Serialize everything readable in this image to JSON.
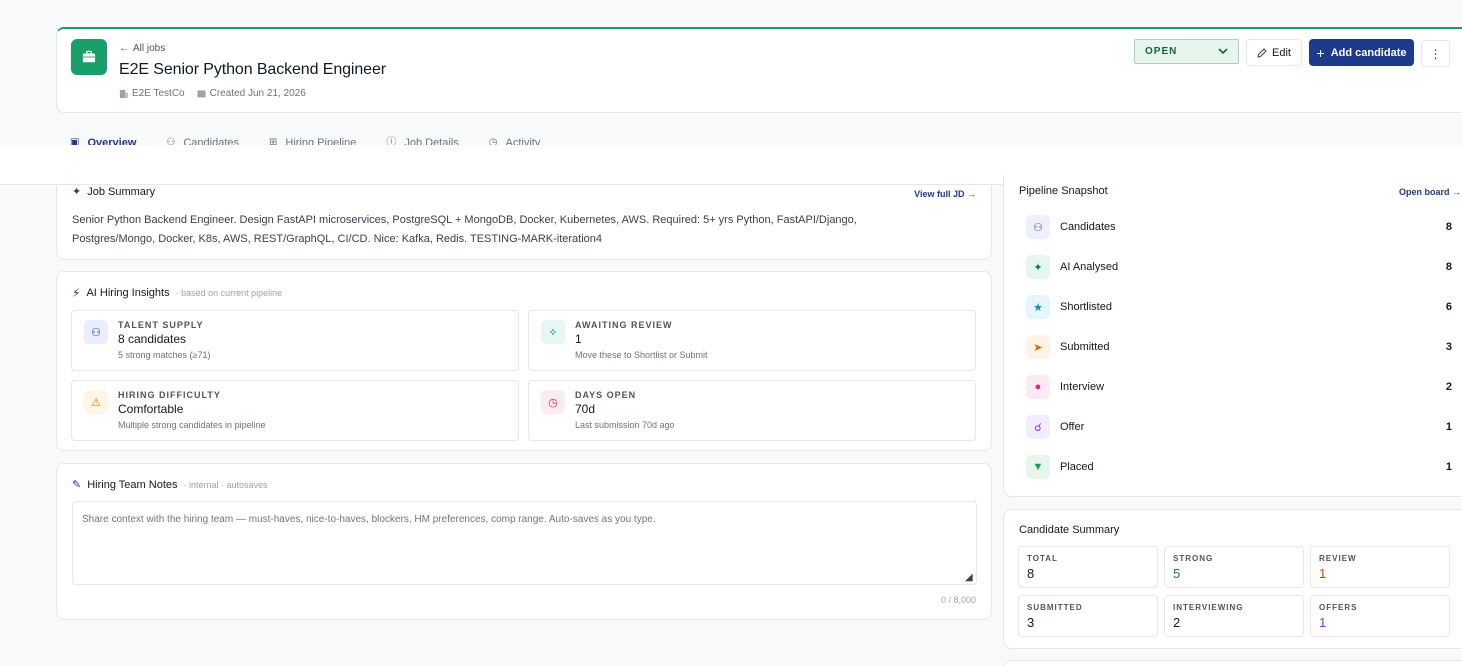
{
  "header": {
    "back_label": "All jobs",
    "title": "E2E Senior Python Backend Engineer",
    "company": "E2E TestCo",
    "created": "Created Jun 21, 2026",
    "status": "OPEN",
    "edit_label": "Edit",
    "add_candidate_label": "Add candidate",
    "more_label": "⋮",
    "colors": {
      "accent": "#1a9f6b",
      "primary": "#1e3a8a"
    }
  },
  "tabs": [
    {
      "label": "Overview",
      "icon": "overview-icon",
      "active": true
    },
    {
      "label": "Candidates",
      "icon": "users-icon",
      "active": false
    },
    {
      "label": "Hiring Pipeline",
      "icon": "kanban-icon",
      "active": false
    },
    {
      "label": "Job Details",
      "icon": "info-icon",
      "active": false
    },
    {
      "label": "Activity",
      "icon": "clock-icon",
      "active": false
    }
  ],
  "job_summary": {
    "title": "Job Summary",
    "link": "View full JD →",
    "text": "Senior Python Backend Engineer. Design FastAPI microservices, PostgreSQL + MongoDB, Docker, Kubernetes, AWS. Required: 5+ yrs Python, FastAPI/Django, Postgres/Mongo, Docker, K8s, AWS, REST/GraphQL, CI/CD. Nice: Kafka, Redis. TESTING-MARK-iteration4"
  },
  "insights": {
    "title": "AI Hiring Insights",
    "subtitle": "· based on current pipeline",
    "cards": [
      {
        "label": "TALENT SUPPLY",
        "value": "8 candidates",
        "sub": "5 strong matches (≥71)",
        "icon": "users-icon"
      },
      {
        "label": "AWAITING REVIEW",
        "value": "1",
        "sub": "Move these to Shortlist or Submit",
        "icon": "sparkle-icon"
      },
      {
        "label": "HIRING DIFFICULTY",
        "value": "Comfortable",
        "sub": "Multiple strong candidates in pipeline",
        "icon": "warning-icon"
      },
      {
        "label": "DAYS OPEN",
        "value": "70d",
        "sub": "Last submission 70d ago",
        "icon": "clock-icon"
      }
    ]
  },
  "notes": {
    "title": "Hiring Team Notes",
    "subtitle": "· internal · autosaves",
    "placeholder": "Share context with the hiring team — must-haves, nice-to-haves, blockers, HM preferences, comp range. Auto-saves as you type.",
    "count": "0 / 8,000"
  },
  "pipeline": {
    "title": "Pipeline Snapshot",
    "link": "Open board →",
    "rows": [
      {
        "label": "Candidates",
        "value": "8",
        "icon": "users-icon"
      },
      {
        "label": "AI Analysed",
        "value": "8",
        "icon": "sparkle-icon"
      },
      {
        "label": "Shortlisted",
        "value": "6",
        "icon": "star-icon"
      },
      {
        "label": "Submitted",
        "value": "3",
        "icon": "send-icon"
      },
      {
        "label": "Interview",
        "value": "2",
        "icon": "chat-icon"
      },
      {
        "label": "Offer",
        "value": "1",
        "icon": "handshake-icon"
      },
      {
        "label": "Placed",
        "value": "1",
        "icon": "trophy-icon"
      }
    ]
  },
  "candidate_summary": {
    "title": "Candidate Summary",
    "stats": [
      {
        "label": "TOTAL",
        "value": "8",
        "color": "#111827"
      },
      {
        "label": "STRONG",
        "value": "5",
        "color": "#15803d"
      },
      {
        "label": "REVIEW",
        "value": "1",
        "color": "#c2410c"
      },
      {
        "label": "SUBMITTED",
        "value": "3",
        "color": "#111827"
      },
      {
        "label": "INTERVIEWING",
        "value": "2",
        "color": "#111827"
      },
      {
        "label": "OFFERS",
        "value": "1",
        "color": "#7c3aed"
      }
    ]
  }
}
